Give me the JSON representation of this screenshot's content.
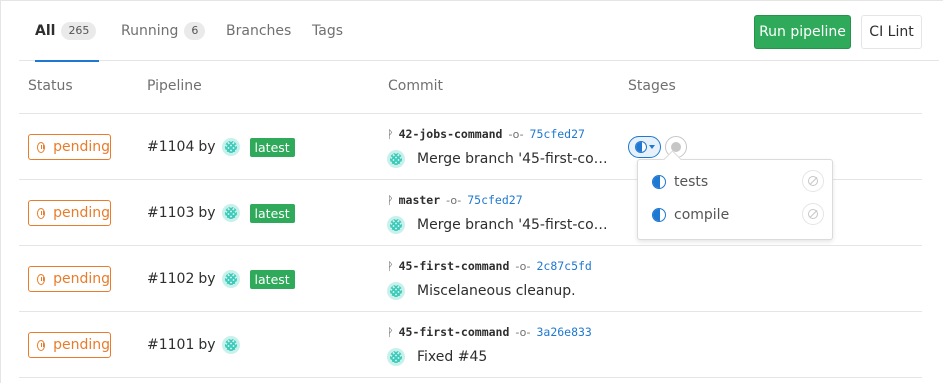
{
  "tabs": [
    {
      "label": "All",
      "count": "265"
    },
    {
      "label": "Running",
      "count": "6"
    },
    {
      "label": "Branches"
    },
    {
      "label": "Tags"
    }
  ],
  "actions": {
    "run_pipeline": "Run pipeline",
    "ci_lint": "CI Lint"
  },
  "columns": {
    "status": "Status",
    "pipeline": "Pipeline",
    "commit": "Commit",
    "stages": "Stages"
  },
  "rows": [
    {
      "status": "pending",
      "id": "#1104",
      "by": "by",
      "tag": "latest",
      "branch": "42-jobs-command",
      "sha": "75cfed27",
      "message": "Merge branch '45-first-command' into master"
    },
    {
      "status": "pending",
      "id": "#1103",
      "by": "by",
      "tag": "latest",
      "branch": "master",
      "sha": "75cfed27",
      "message": "Merge branch '45-first-command' into master"
    },
    {
      "status": "pending",
      "id": "#1102",
      "by": "by",
      "tag": "latest",
      "branch": "45-first-command",
      "sha": "2c87c5fd",
      "message": "Miscelaneous cleanup."
    },
    {
      "status": "pending",
      "id": "#1101",
      "by": "by",
      "tag": "",
      "branch": "45-first-command",
      "sha": "3a26e833",
      "message": "Fixed #45"
    }
  ],
  "stage_dropdown": {
    "items": [
      {
        "label": "tests"
      },
      {
        "label": "compile"
      }
    ]
  },
  "colors": {
    "accent": "#1f78d1",
    "success": "#2eaa5a",
    "pending": "#e97c2a"
  },
  "icons": {
    "status": "pause-circle-icon",
    "branch": "branch-icon",
    "commit": "commit-icon",
    "stage_running": "running-icon",
    "stage_created": "created-icon",
    "cancel": "cancel-icon"
  }
}
